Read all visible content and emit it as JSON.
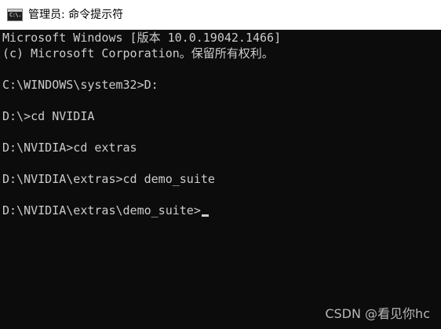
{
  "window": {
    "title": "管理员: 命令提示符",
    "icon": "console-icon",
    "icon_glyph": "C:\\."
  },
  "console": {
    "lines": [
      "Microsoft Windows [版本 10.0.19042.1466]",
      "(c) Microsoft Corporation。保留所有权利。",
      "",
      "C:\\WINDOWS\\system32>D:",
      "",
      "D:\\>cd NVIDIA",
      "",
      "D:\\NVIDIA>cd extras",
      "",
      "D:\\NVIDIA\\extras>cd demo_suite",
      "",
      "D:\\NVIDIA\\extras\\demo_suite>"
    ]
  },
  "watermark": {
    "text": "CSDN @看见你hc"
  },
  "colors": {
    "console_background": "#0c0c0c",
    "console_text": "#cccccc",
    "titlebar_background": "#ffffff"
  }
}
